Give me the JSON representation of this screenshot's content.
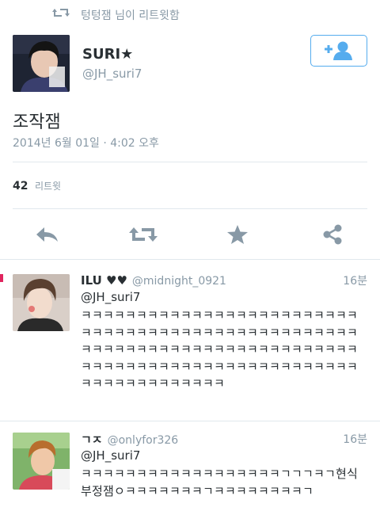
{
  "retweet_banner": {
    "text": "텅텅잼 님이 리트윗함"
  },
  "author": {
    "name": "SURI★",
    "handle": "@JH_suri7"
  },
  "tweet": {
    "text": "조작잼",
    "timestamp": "2014년 6월 01일 · 4:02 오후"
  },
  "stats": {
    "retweet_count": "42",
    "retweet_label": "리트윗"
  },
  "colors": {
    "accent": "#55acee",
    "muted": "#8899a6",
    "divider": "#e1e8ed"
  },
  "actions": [
    "reply-icon",
    "retweet-icon",
    "favorite-icon",
    "share-icon"
  ],
  "replies": [
    {
      "name": "ILU ♥♥",
      "handle": "@midnight_0921",
      "time": "16분",
      "reply_to": "@JH_suri7",
      "body": "ㅋㅋㅋㅋㅋㅋㅋㅋㅋㅋㅋㅋㅋㅋㅋㅋㅋㅋㅋㅋㅋㅋㅋㅋㅋㅋㅋㅋㅋㅋㅋㅋㅋㅋㅋㅋㅋㅋㅋㅋㅋㅋㅋㅋㅋㅋㅋㅋㅋㅋㅋㅋㅋㅋㅋㅋㅋㅋㅋㅋㅋㅋㅋㅋㅋㅋㅋㅋㅋㅋㅋㅋㅋㅋㅋㅋㅋㅋㅋㅋㅋㅋㅋㅋㅋㅋㅋㅋㅋㅋㅋㅋㅋㅋㅋㅋㅋㅋㅋㅋㅋㅋㅋㅋㅋㅋㅋㅋㅋㅋㅋㅋㅋ"
    },
    {
      "name": "ㄱㅈ",
      "handle": "@onlyfor326",
      "time": "16분",
      "reply_to": "@JH_suri7",
      "body": "ㅋㅋㅋㅋㅋㅋㅋㅋㅋㅋㅋㅋㅋㅋㅋㅋㅋㅋㄱㄱㄱㅋㄱ현식부정잼ㅇㅋㅋㅋㅋㅋㅋㅋㄱㅋㅋㅋㅋㅋㅋㅋㅋㄱ"
    }
  ]
}
